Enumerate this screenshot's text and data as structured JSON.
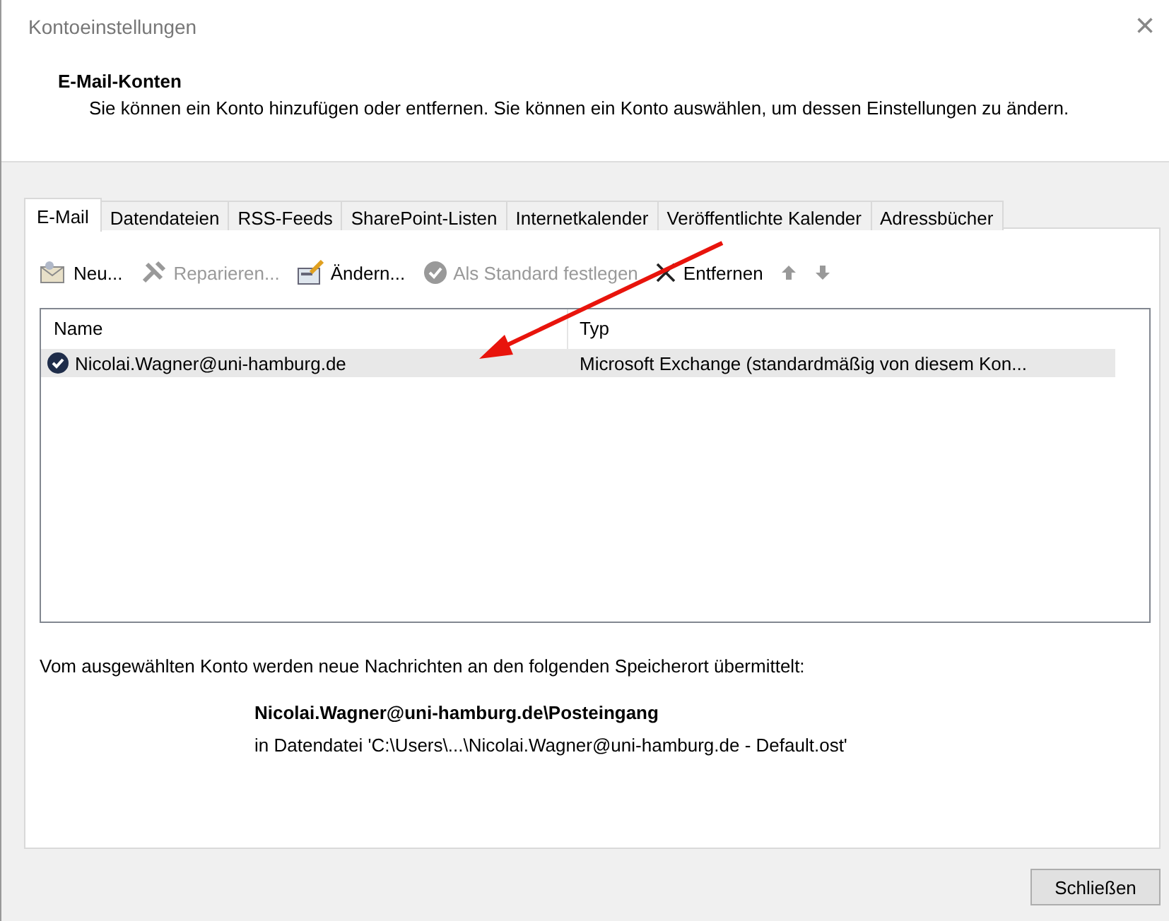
{
  "window": {
    "title": "Kontoeinstellungen",
    "close": "×"
  },
  "header": {
    "title": "E-Mail-Konten",
    "description": "Sie können ein Konto hinzufügen oder entfernen. Sie können ein Konto auswählen, um dessen Einstellungen zu ändern."
  },
  "tabs": [
    {
      "label": "E-Mail",
      "selected": true
    },
    {
      "label": "Datendateien",
      "selected": false
    },
    {
      "label": "RSS-Feeds",
      "selected": false
    },
    {
      "label": "SharePoint-Listen",
      "selected": false
    },
    {
      "label": "Internetkalender",
      "selected": false
    },
    {
      "label": "Veröffentlichte Kalender",
      "selected": false
    },
    {
      "label": "Adressbücher",
      "selected": false
    }
  ],
  "toolbar": [
    {
      "kind": "new",
      "label": "Neu...",
      "disabled": false
    },
    {
      "kind": "repair",
      "label": "Reparieren...",
      "disabled": true
    },
    {
      "kind": "change",
      "label": "Ändern...",
      "disabled": false
    },
    {
      "kind": "default",
      "label": "Als Standard festlegen",
      "disabled": true
    },
    {
      "kind": "remove",
      "label": "Entfernen",
      "disabled": false
    },
    {
      "kind": "up",
      "disabled": true
    },
    {
      "kind": "down",
      "disabled": true
    }
  ],
  "table": {
    "columns": [
      "Name",
      "Typ"
    ],
    "rows": [
      {
        "name": "Nicolai.Wagner@uni-hamburg.de",
        "type": "Microsoft Exchange (standardmäßig von diesem Kon...",
        "selected": true,
        "default": true
      }
    ]
  },
  "delivery": {
    "intro": "Vom ausgewählten Konto werden neue Nachrichten an den folgenden Speicherort übermittelt:",
    "folder": "Nicolai.Wagner@uni-hamburg.de\\Posteingang",
    "file": "in Datendatei 'C:\\Users\\...\\Nicolai.Wagner@uni-hamburg.de - Default.ost'"
  },
  "buttons": [
    "Schließen"
  ]
}
